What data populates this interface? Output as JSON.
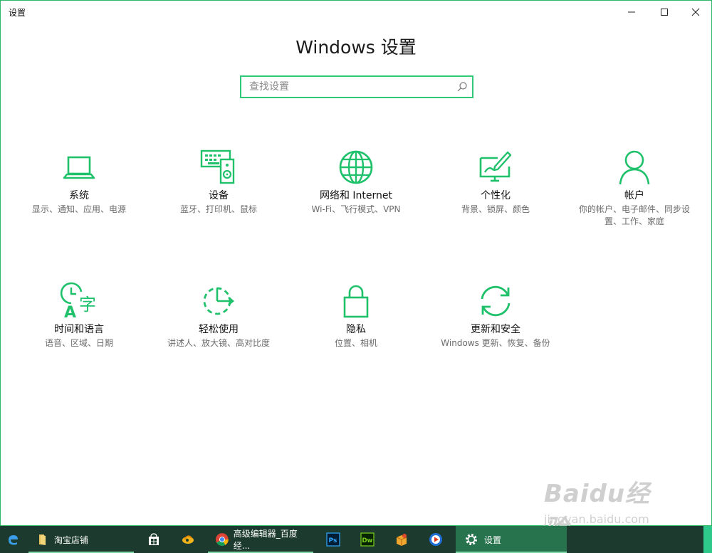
{
  "window": {
    "title": "设置",
    "heading": "Windows 设置",
    "accent": "#1fc16b"
  },
  "search": {
    "placeholder": "查找设置",
    "value": ""
  },
  "tiles": [
    {
      "name": "系统",
      "desc": "显示、通知、应用、电源",
      "icon": "laptop-icon"
    },
    {
      "name": "设备",
      "desc": "蓝牙、打印机、鼠标",
      "icon": "devices-icon"
    },
    {
      "name": "网络和 Internet",
      "desc": "Wi-Fi、飞行模式、VPN",
      "icon": "globe-icon"
    },
    {
      "name": "个性化",
      "desc": "背景、锁屏、颜色",
      "icon": "paint-icon"
    },
    {
      "name": "帐户",
      "desc": "你的帐户、电子邮件、同步设置、工作、家庭",
      "icon": "person-icon"
    },
    {
      "name": "时间和语言",
      "desc": "语音、区域、日期",
      "icon": "time-language-icon"
    },
    {
      "name": "轻松使用",
      "desc": "讲述人、放大镜、高对比度",
      "icon": "ease-of-access-icon"
    },
    {
      "name": "隐私",
      "desc": "位置、相机",
      "icon": "lock-icon"
    },
    {
      "name": "更新和安全",
      "desc": "Windows 更新、恢复、备份",
      "icon": "sync-icon"
    }
  ],
  "taskbar": {
    "items": [
      {
        "label": "淘宝店铺",
        "icon": "folder-icon"
      },
      {
        "label": "高级编辑器_百度经...",
        "icon": "chrome-icon"
      },
      {
        "label": "设置",
        "icon": "gear-icon"
      }
    ]
  },
  "watermark": {
    "line1": "Baidu经验",
    "line2": "jingyan.baidu.com"
  }
}
